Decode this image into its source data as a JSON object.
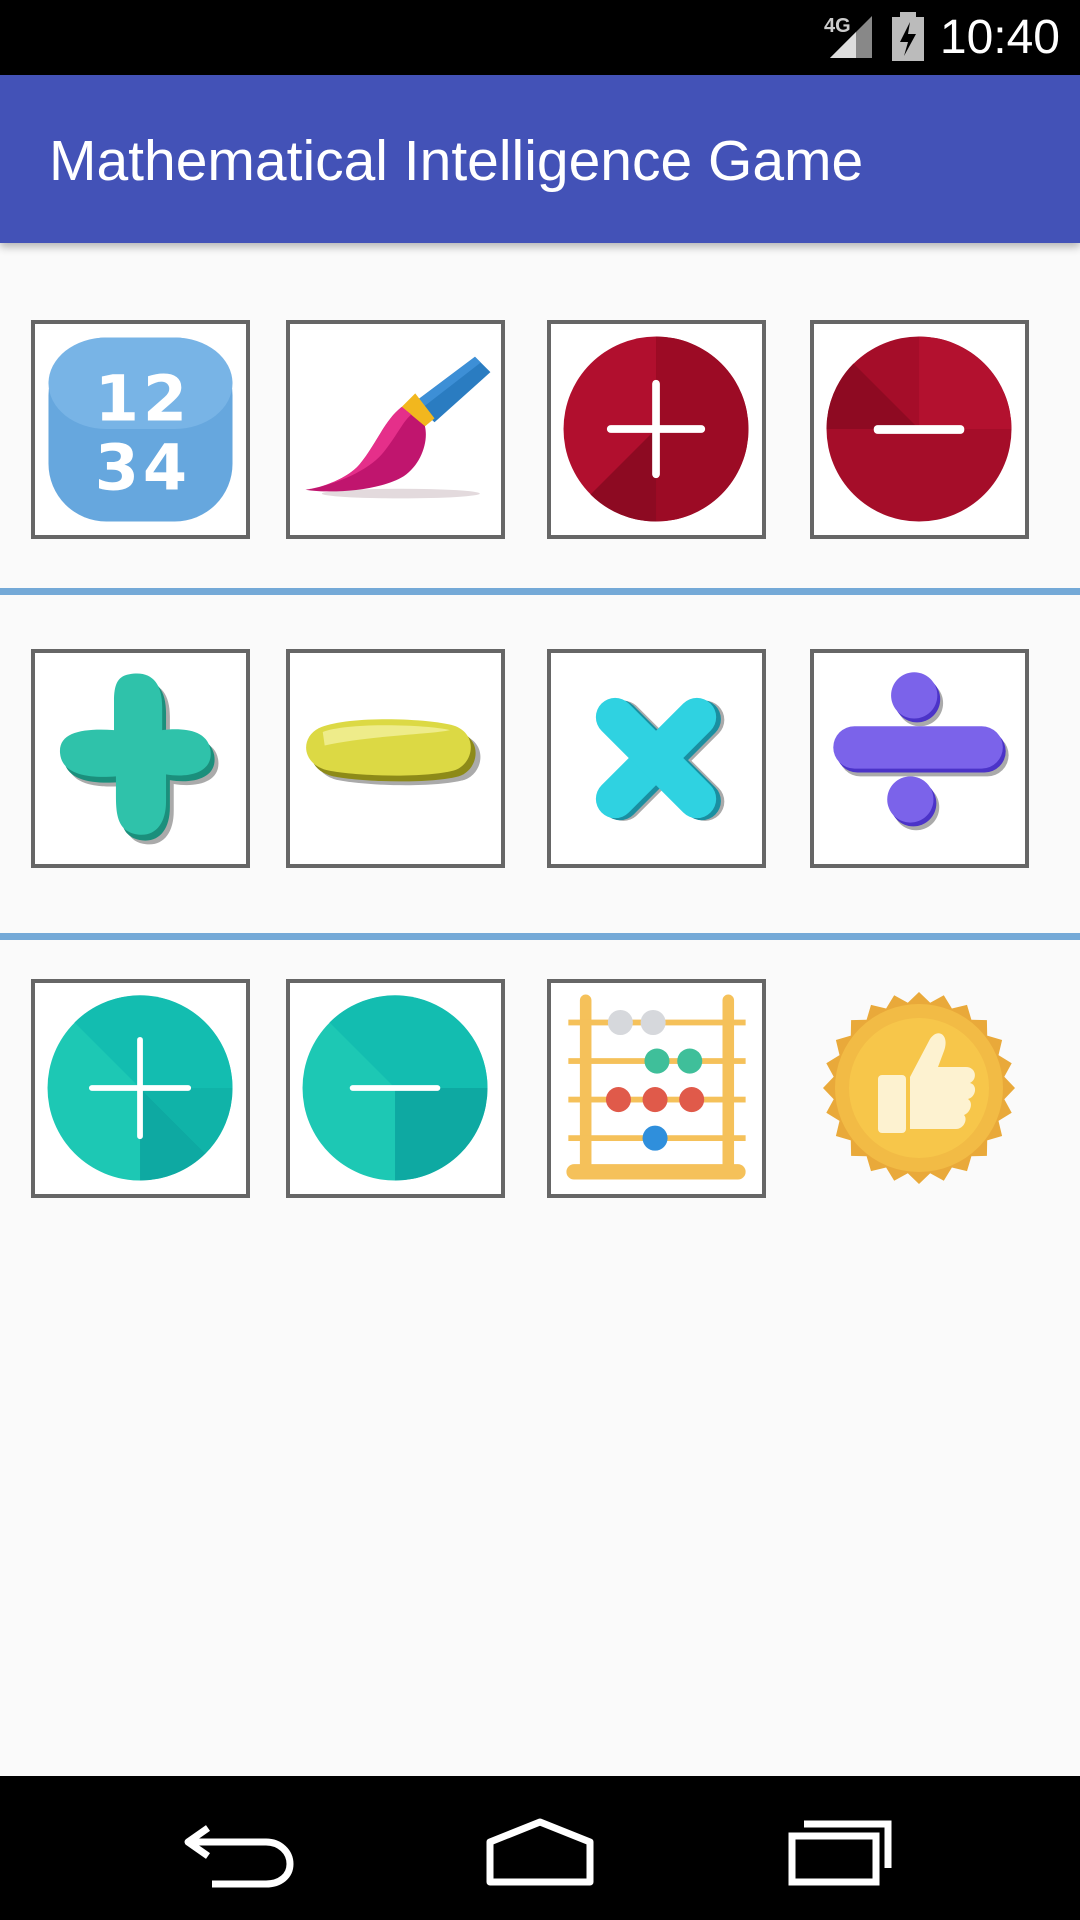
{
  "status_bar": {
    "time": "10:40",
    "network": "4G",
    "icons": [
      "signal-icon",
      "battery-charging-icon"
    ]
  },
  "app_bar": {
    "title": "Mathematical Intelligence Game"
  },
  "grid": {
    "rows": [
      [
        "numbers-icon",
        "paintbrush-icon",
        "red-plus-icon",
        "red-minus-icon"
      ],
      [
        "green-plus-icon",
        "yellow-minus-icon",
        "cyan-times-icon",
        "purple-divide-icon"
      ],
      [
        "teal-plus-icon",
        "teal-minus-icon",
        "abacus-icon",
        "thumbs-up-medal-icon"
      ]
    ],
    "numbers_tile": {
      "digits": [
        "1",
        "2",
        "3",
        "4"
      ]
    }
  },
  "colors": {
    "app_bar": "#4352b7",
    "divider": "#74a9d7",
    "red": "#a80d2a",
    "teal": "#1dc8b4"
  },
  "nav_bar": {
    "buttons": [
      "back-icon",
      "home-icon",
      "recents-icon"
    ]
  }
}
